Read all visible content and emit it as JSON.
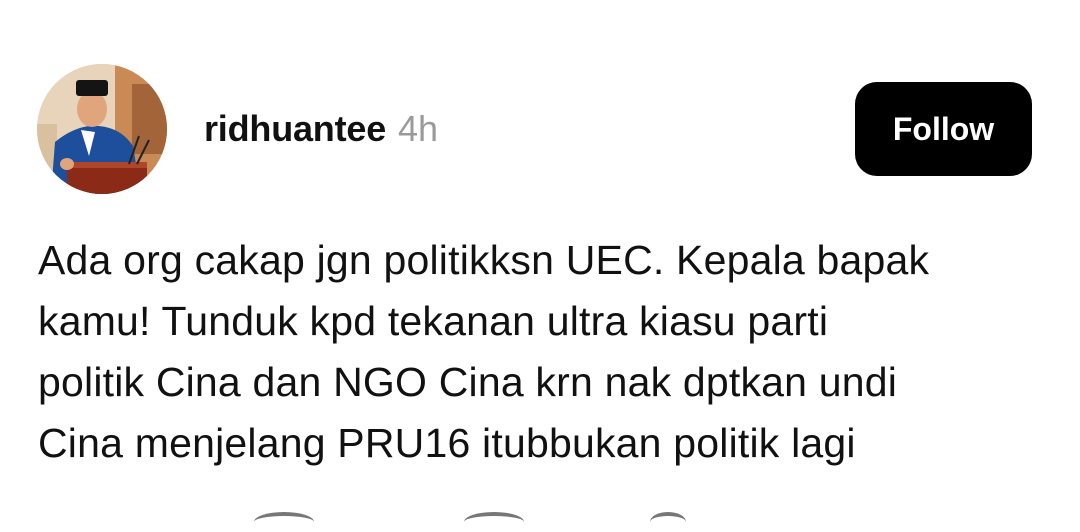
{
  "post": {
    "author": {
      "username": "ridhuantee",
      "time_ago": "4h",
      "avatar_icon": "profile-photo"
    },
    "follow_label": "Follow",
    "body_lines": [
      "Ada org cakap jgn politikksn UEC. Kepala bapak",
      "kamu! Tunduk kpd tekanan ultra kiasu parti",
      "politik Cina dan NGO Cina krn nak dptkan undi",
      "Cina menjelang PRU16 itubbukan politik lagi"
    ]
  },
  "actions": {
    "icons": [
      "like-icon",
      "comment-icon",
      "repost-icon"
    ]
  },
  "colors": {
    "follow_bg": "#000000",
    "follow_text": "#ffffff",
    "time_text": "#9a9a9a"
  }
}
